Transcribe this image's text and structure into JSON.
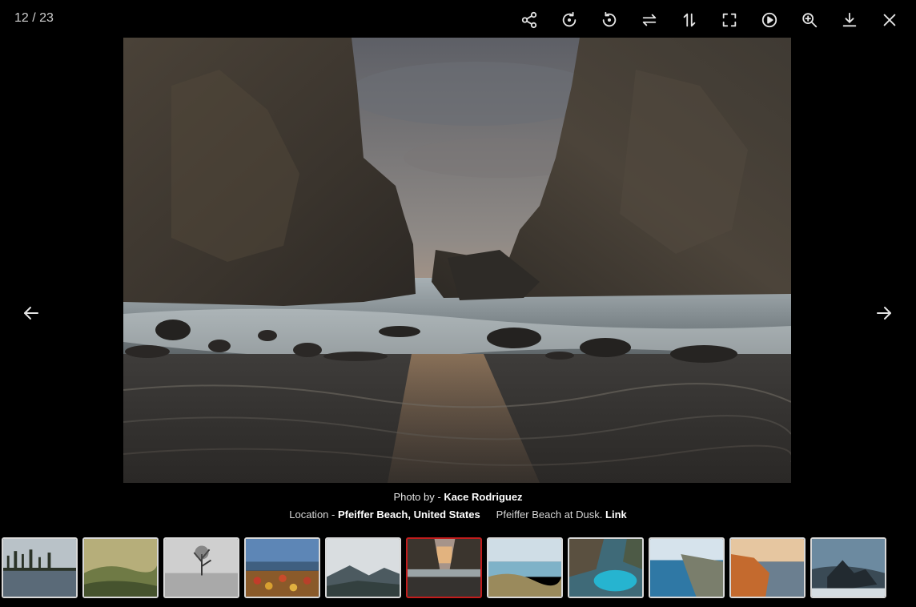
{
  "counter": "12 / 23",
  "toolbar": {
    "icons": [
      "share-icon",
      "rotate-right-icon",
      "rotate-left-icon",
      "flip-horizontal-icon",
      "flip-vertical-icon",
      "fullscreen-icon",
      "play-icon",
      "zoom-in-icon",
      "download-icon",
      "close-icon"
    ]
  },
  "caption": {
    "photo_by_prefix": "Photo by - ",
    "photographer": "Kace Rodriguez",
    "location_prefix": "Location - ",
    "location": "Pfeiffer Beach, United States",
    "description": "Pfeiffer Beach at Dusk. ",
    "link_label": "Link"
  },
  "navigation": {
    "prev_icon": "arrow-left-icon",
    "next_icon": "arrow-right-icon"
  },
  "thumbnails": {
    "count": 11,
    "active_index": 5,
    "active_border_color": "#c21d1d"
  }
}
